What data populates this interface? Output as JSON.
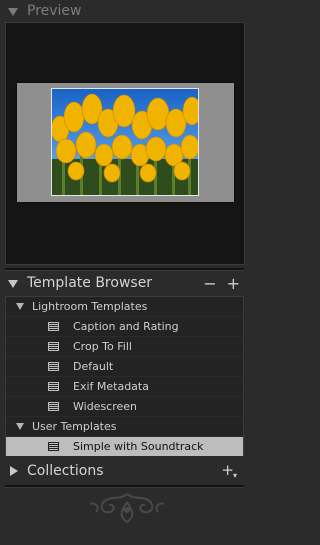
{
  "preview": {
    "title": "Preview"
  },
  "template_browser": {
    "title": "Template Browser",
    "remove_label": "−",
    "add_label": "+",
    "folders": [
      {
        "label": "Lightroom Templates",
        "items": [
          "Caption and Rating",
          "Crop To Fill",
          "Default",
          "Exif Metadata",
          "Widescreen"
        ]
      },
      {
        "label": "User Templates",
        "items": [
          "Simple with Soundtrack"
        ]
      }
    ],
    "selected_item": "Simple with Soundtrack"
  },
  "collections": {
    "title": "Collections",
    "add_label": "+"
  },
  "colors": {
    "panel_bg": "#2b2b2b",
    "list_bg": "#232323",
    "selected_bg": "#bdbdbd",
    "text": "#cfcfcf"
  }
}
